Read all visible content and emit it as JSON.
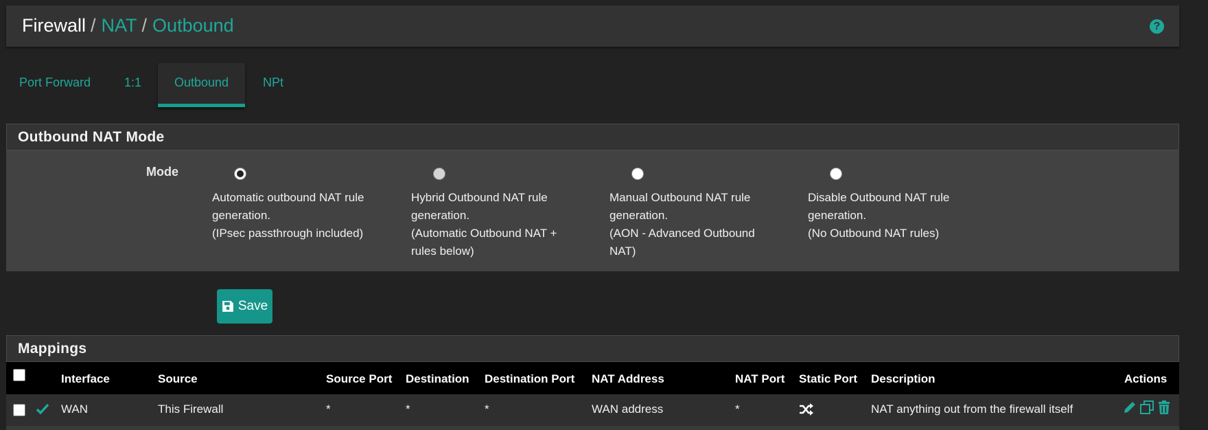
{
  "breadcrumb": {
    "root": "Firewall",
    "level2": "NAT",
    "current": "Outbound",
    "separator": "/"
  },
  "help_icon": "question-circle-icon",
  "tabs": [
    {
      "label": "Port Forward"
    },
    {
      "label": "1:1"
    },
    {
      "label": "Outbound",
      "active": true
    },
    {
      "label": "NPt"
    }
  ],
  "mode_panel": {
    "title": "Outbound NAT Mode",
    "mode_label": "Mode",
    "options": [
      {
        "lines": [
          "Automatic outbound NAT rule",
          "generation.",
          "(IPsec passthrough included)"
        ],
        "selected": true
      },
      {
        "lines": [
          "Hybrid Outbound NAT rule",
          "generation.",
          "(Automatic Outbound NAT +",
          "rules below)"
        ],
        "selected": false
      },
      {
        "lines": [
          "Manual Outbound NAT rule",
          "generation.",
          "(AON - Advanced Outbound",
          "NAT)"
        ],
        "selected": false
      },
      {
        "lines": [
          "Disable Outbound NAT rule",
          "generation.",
          "(No Outbound NAT rules)"
        ],
        "selected": false
      }
    ]
  },
  "save_button": {
    "label": "Save",
    "icon": "floppy-disk-icon"
  },
  "mappings": {
    "title": "Mappings",
    "columns": [
      "Interface",
      "Source",
      "Source Port",
      "Destination",
      "Destination Port",
      "NAT Address",
      "NAT Port",
      "Static Port",
      "Description",
      "Actions"
    ],
    "rows": [
      {
        "enabled_icon": "check-icon",
        "interface": "WAN",
        "source": "This Firewall",
        "source_port": "*",
        "destination": "*",
        "destination_port": "*",
        "nat_address": "WAN address",
        "nat_port": "*",
        "static_port_icon": "shuffle-icon",
        "description": "NAT anything out from the firewall itself",
        "action_icons": [
          "pencil-icon",
          "copy-icon",
          "trash-icon"
        ]
      }
    ]
  },
  "colors": {
    "accent": "#1fa89a",
    "button": "#16968a",
    "panel": "#424242",
    "header": "#333333",
    "background": "#222222"
  }
}
